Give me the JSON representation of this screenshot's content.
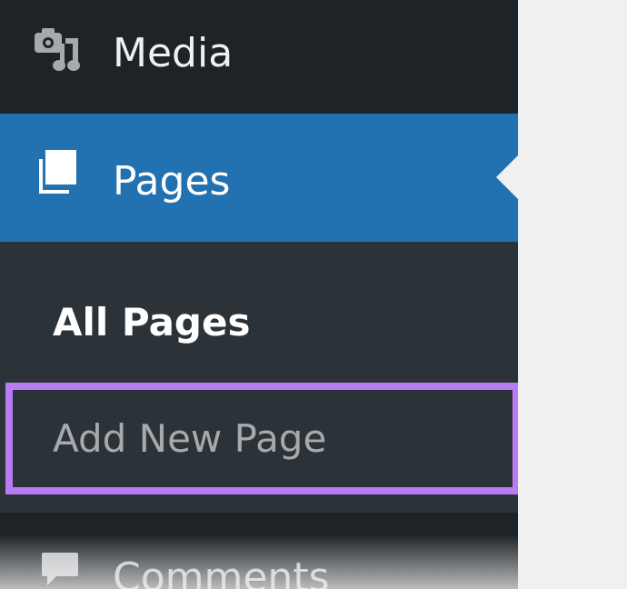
{
  "sidebar": {
    "items": [
      {
        "id": "media",
        "label": "Media",
        "icon": "media-icon"
      },
      {
        "id": "pages",
        "label": "Pages",
        "icon": "pages-icon",
        "current": true
      },
      {
        "id": "comments",
        "label": "Comments",
        "icon": "comments-icon"
      }
    ],
    "submenu": {
      "parent": "pages",
      "items": [
        {
          "label": "All Pages",
          "current": true
        },
        {
          "label": "Add New Page",
          "highlighted": true
        }
      ]
    }
  },
  "colors": {
    "sidebar_bg": "#1d2327",
    "submenu_bg": "#2c3338",
    "active_bg": "#2271b1",
    "highlight_border": "#b77cf4",
    "content_bg": "#f0f0f1"
  }
}
